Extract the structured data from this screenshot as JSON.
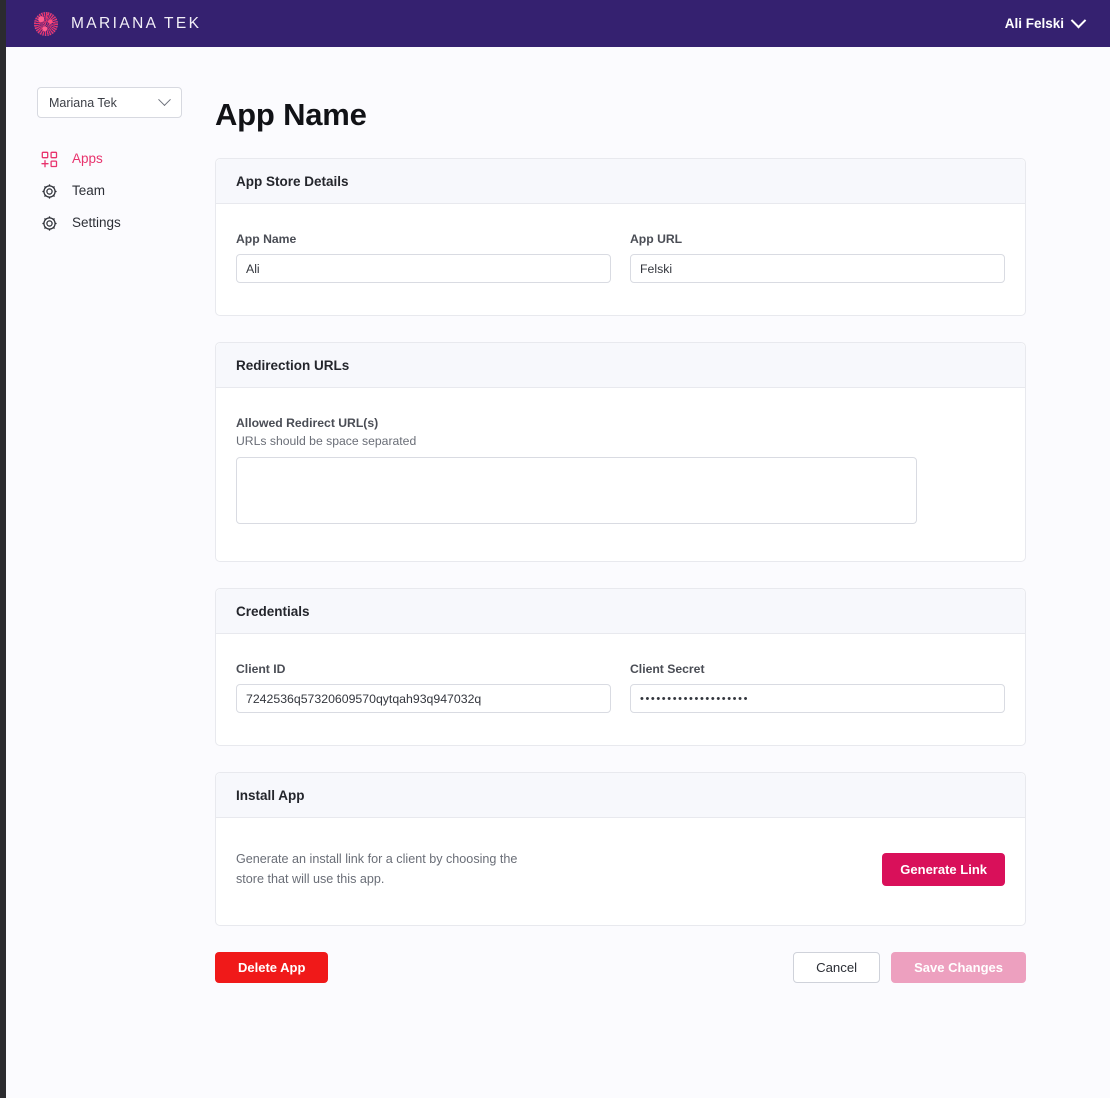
{
  "topbar": {
    "logo_icon": "mariana-tek-logo-icon",
    "brand": "MARIANA TEK",
    "user_name": "Ali Felski",
    "user_chevron_icon": "chevron-down-icon",
    "background_color": "#352170"
  },
  "sidebar": {
    "org_select": {
      "value": "Mariana Tek",
      "chevron_icon": "chevron-down-icon"
    },
    "items": [
      {
        "label": "Apps",
        "icon": "apps-grid-plus-icon",
        "active": true
      },
      {
        "label": "Team",
        "icon": "gear-icon",
        "active": false
      },
      {
        "label": "Settings",
        "icon": "gear-icon",
        "active": false
      }
    ],
    "active_color": "#e8336d"
  },
  "main": {
    "page_title": "App Name",
    "cards": {
      "app_store_details": {
        "title": "App Store Details",
        "fields": [
          {
            "label": "App Name",
            "value": "Ali",
            "placeholder": ""
          },
          {
            "label": "App URL",
            "value": "Felski",
            "placeholder": ""
          }
        ]
      },
      "redirection_urls": {
        "title": "Redirection URLs",
        "field_label": "Allowed Redirect URL(s)",
        "field_help": "URLs should be space separated",
        "value": "",
        "placeholder": ""
      },
      "credentials": {
        "title": "Credentials",
        "fields": [
          {
            "label": "Client ID",
            "value": "7242536q57320609570qytqah93q947032q",
            "placeholder": ""
          },
          {
            "label": "Client Secret",
            "value": "••••••••••••••••••••",
            "placeholder": ""
          }
        ]
      },
      "install_app": {
        "title": "Install App",
        "description": "Generate an install link for a client by choosing the store that will use this app.",
        "button_label": "Generate Link",
        "button_color": "#d9105a"
      }
    },
    "footer": {
      "delete_label": "Delete App",
      "delete_color": "#f01919",
      "cancel_label": "Cancel",
      "save_label": "Save Changes",
      "save_disabled_color": "#eda0bf"
    }
  }
}
